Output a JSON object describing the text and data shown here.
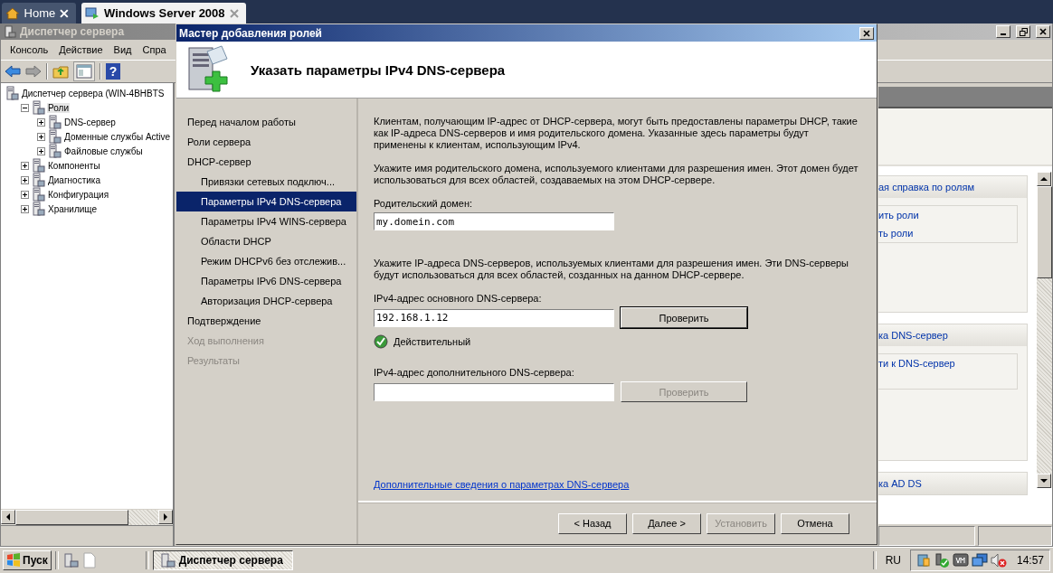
{
  "browser_tabs": [
    {
      "label": "Home",
      "selected": false
    },
    {
      "label": "Windows Server 2008",
      "selected": true
    }
  ],
  "main_window": {
    "title": "Диспетчер сервера",
    "menu": [
      "Консоль",
      "Действие",
      "Вид",
      "Спра"
    ],
    "help_button": "?",
    "tree": [
      {
        "label": "Диспетчер сервера (WIN-4BHBTS",
        "selected": false,
        "children": [
          {
            "label": "Роли",
            "expanded": true,
            "selected": true,
            "children": [
              {
                "label": "DNS-сервер",
                "expanded": false,
                "selected": false
              },
              {
                "label": "Доменные службы Active",
                "expanded": false,
                "selected": false
              },
              {
                "label": "Файловые службы",
                "expanded": false,
                "selected": false
              }
            ]
          },
          {
            "label": "Компоненты",
            "expanded": false,
            "selected": false
          },
          {
            "label": "Диагностика",
            "expanded": false,
            "selected": false
          },
          {
            "label": "Конфигурация",
            "expanded": false,
            "selected": false
          },
          {
            "label": "Хранилище",
            "expanded": false,
            "selected": false
          }
        ]
      }
    ],
    "right_sections": [
      {
        "title": "ая справка по ролям",
        "links": [
          "ить роли",
          "ть роли"
        ]
      },
      {
        "title": "ка DNS-сервер",
        "links": [
          "ти к DNS-сервер"
        ]
      },
      {
        "title": "ка AD DS"
      }
    ]
  },
  "wizard": {
    "title": "Мастер добавления ролей",
    "heading": "Указать параметры IPv4 DNS-сервера",
    "steps": [
      {
        "label": "Перед началом работы",
        "selected": false,
        "disabled": false
      },
      {
        "label": "Роли сервера",
        "selected": false,
        "disabled": false
      },
      {
        "label": "DHCP-сервер",
        "selected": false,
        "disabled": false,
        "children": [
          {
            "label": "Привязки сетевых подключ...",
            "selected": false,
            "disabled": false
          },
          {
            "label": "Параметры IPv4 DNS-сервера",
            "selected": true,
            "disabled": false
          },
          {
            "label": "Параметры IPv4 WINS-сервера",
            "selected": false,
            "disabled": false
          },
          {
            "label": "Области DHCP",
            "selected": false,
            "disabled": false
          },
          {
            "label": "Режим DHCPv6 без отслежив...",
            "selected": false,
            "disabled": false
          },
          {
            "label": "Параметры IPv6 DNS-сервера",
            "selected": false,
            "disabled": false
          },
          {
            "label": "Авторизация DHCP-сервера",
            "selected": false,
            "disabled": false
          }
        ]
      },
      {
        "label": "Подтверждение",
        "selected": false,
        "disabled": false
      },
      {
        "label": "Ход выполнения",
        "selected": false,
        "disabled": true
      },
      {
        "label": "Результаты",
        "selected": false,
        "disabled": true
      }
    ],
    "intro": "Клиентам, получающим IP-адрес от DHCP-сервера, могут быть предоставлены параметры DHCP, такие как IP-адреса DNS-серверов и имя родительского домена. Указанные здесь параметры будут применены к клиентам, использующим IPv4.",
    "domain_hint": "Укажите имя родительского домена, используемого клиентами для разрешения имен. Этот домен будет использоваться для всех областей, создаваемых на этом DHCP-сервере.",
    "parent_domain": {
      "label": "Родительский домен:",
      "value": "my.domein.com"
    },
    "dns_hint": "Укажите IP-адреса DNS-серверов, используемых клиентами для разрешения имен. Эти DNS-серверы будут использоваться для всех областей, созданных на данном DHCP-сервере.",
    "dns_fields": [
      {
        "label": "IPv4-адрес основного DNS-сервера:",
        "value": "192.168.1.12",
        "button": "Проверить",
        "button_disabled": false,
        "focused": true,
        "status": "Действительный",
        "valid": true
      },
      {
        "label": "IPv4-адрес дополнительного DNS-сервера:",
        "button": "Проверить",
        "button_disabled": true,
        "focused": false
      }
    ],
    "more_link": "Дополнительные сведения о параметрах DNS-сервера",
    "buttons": [
      {
        "label": "< Назад",
        "disabled": false
      },
      {
        "label": "Далее >",
        "disabled": false
      },
      {
        "label": "Установить",
        "disabled": true
      },
      {
        "label": "Отмена",
        "disabled": false
      }
    ]
  },
  "taskbar": {
    "start": "Пуск",
    "tasks": [
      {
        "label": "Диспетчер сервера",
        "selected": true
      }
    ],
    "language": "RU",
    "clock": "14:57"
  }
}
